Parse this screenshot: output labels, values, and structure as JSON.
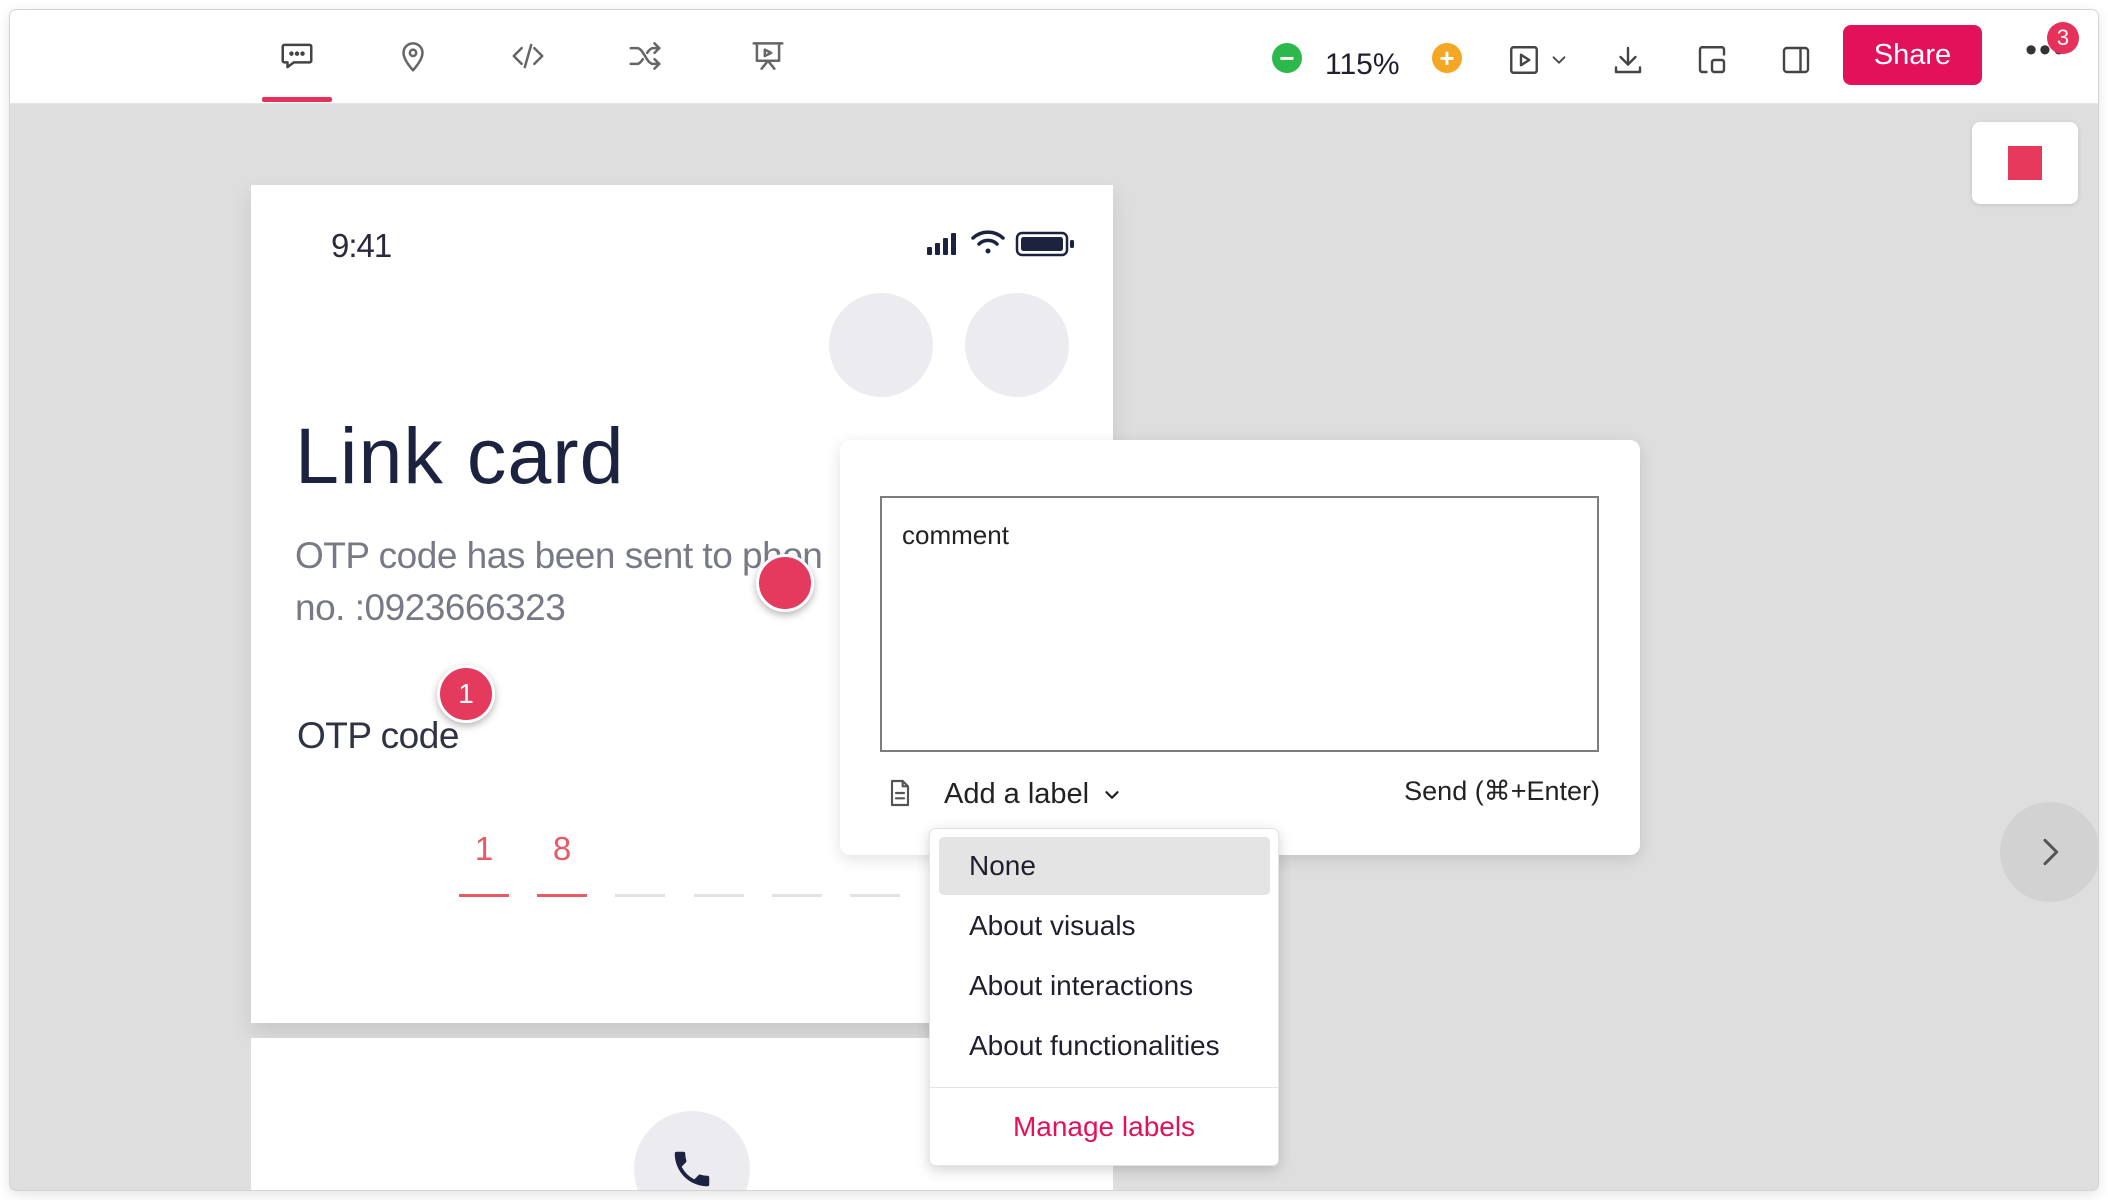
{
  "toolbar": {
    "tools": [
      {
        "name": "comment-icon",
        "active": true
      },
      {
        "name": "pin-icon",
        "active": false
      },
      {
        "name": "code-icon",
        "active": false
      },
      {
        "name": "shuffle-icon",
        "active": false
      },
      {
        "name": "presentation-icon",
        "active": false
      }
    ],
    "zoom_label": "115%",
    "share_label": "Share",
    "more_badge": "3",
    "colors": {
      "accent": "#e3105a",
      "zoom_out": "#2db84b",
      "zoom_in": "#f5a623"
    }
  },
  "prototype": {
    "status_time": "9:41",
    "title": "Link card",
    "description": "OTP code has been sent to phon\nno.  :0923666323",
    "otp_label": "OTP code",
    "otp_digits": [
      "1",
      "8",
      "",
      "",
      "",
      ""
    ]
  },
  "pins": {
    "numbered_pin": "1"
  },
  "comment": {
    "text": "comment",
    "add_label": "Add a label",
    "send_label": "Send (⌘+Enter)"
  },
  "label_menu": {
    "items": [
      "None",
      "About visuals",
      "About interactions",
      "About functionalities"
    ],
    "selected": "None",
    "manage_label": "Manage labels"
  }
}
